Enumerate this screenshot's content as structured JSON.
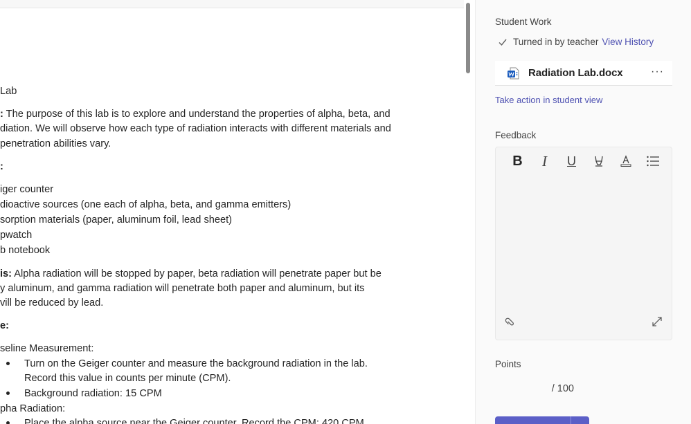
{
  "document": {
    "title_fragment": "Lab",
    "objective": {
      "label": ":",
      "lines": [
        " The purpose of this lab is to explore and understand the properties of alpha, beta, and",
        "diation. We will observe how each type of radiation interacts with different materials and",
        "penetration abilities vary."
      ]
    },
    "materials": {
      "label": ":",
      "items": [
        "iger counter",
        "dioactive sources (one each of alpha, beta, and gamma emitters)",
        "sorption materials (paper, aluminum foil, lead sheet)",
        "pwatch",
        "b notebook"
      ]
    },
    "hypothesis": {
      "label": "is:",
      "lines": [
        " Alpha radiation will be stopped by paper, beta radiation will penetrate paper but be",
        "y aluminum, and gamma radiation will penetrate both paper and aluminum, but its",
        "vill be reduced by lead."
      ]
    },
    "procedure": {
      "label": "e:",
      "step1": "seline Measurement:",
      "step1_bullets": [
        "Turn on the Geiger counter and measure the background radiation in the lab.",
        "Record this value in counts per minute (CPM).",
        "Background radiation: 15 CPM"
      ],
      "step2": "pha Radiation:",
      "step2_bullets": [
        "Place the alpha source near the Geiger counter. Record the CPM: 420 CPM"
      ]
    }
  },
  "side_panel": {
    "student_work_label": "Student Work",
    "status_text": "Turned in by teacher",
    "view_history": "View History",
    "file": {
      "name": "Radiation Lab.docx",
      "icon": "word-doc-icon",
      "more": "···"
    },
    "take_action": "Take action in student view",
    "feedback_label": "Feedback",
    "toolbar": {
      "bold": "B",
      "italic": "I",
      "underline": "U",
      "highlight": "⌂",
      "font_color": "A",
      "list": "☰"
    },
    "points_label": "Points",
    "points_total": "/ 100"
  },
  "colors": {
    "accent": "#4f52b2",
    "primary_button": "#5b5fc7",
    "word_blue": "#185abd"
  }
}
